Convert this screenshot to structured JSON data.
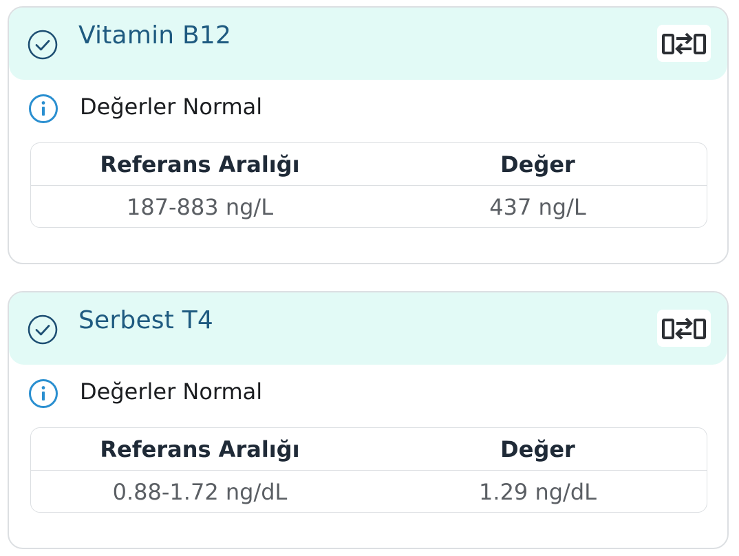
{
  "results": [
    {
      "title": "Vitamin B12",
      "status": "Değerler Normal",
      "headers": {
        "range": "Referans Aralığı",
        "value": "Değer"
      },
      "range": "187-883 ng/L",
      "value": "437 ng/L"
    },
    {
      "title": "Serbest T4",
      "status": "Değerler Normal",
      "headers": {
        "range": "Referans Aralığı",
        "value": "Değer"
      },
      "range": "0.88-1.72 ng/dL",
      "value": "1.29 ng/dL"
    }
  ],
  "icons": {
    "status": "check-circle-icon",
    "info": "info-circle-icon",
    "compare": "compare-arrows-icon"
  },
  "colors": {
    "header_bg": "#e2faf6",
    "title": "#1e5a80",
    "info": "#2a8fd0",
    "border": "#dcdfe2"
  }
}
